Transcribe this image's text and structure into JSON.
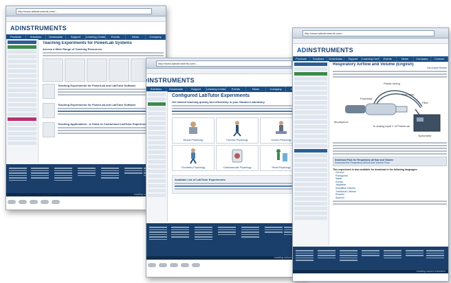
{
  "address_url": "http://www.adinstruments.com/...",
  "logo": {
    "ad": "AD",
    "rest": "INSTRUMENTS"
  },
  "nav_items": [
    "Products",
    "Solutions",
    "Downloads",
    "Support",
    "Learning Center",
    "Events",
    "News",
    "Company",
    "Contact"
  ],
  "back_page": {
    "title": "Teaching Experiments for PowerLab Systems",
    "subtitle": "Access a Wide Range of Teaching Resources",
    "sec1": "Teaching Experiments for PowerLab and LabTutor Software",
    "sec2": "Teaching Experiments for PowerLab and LabTutor Software",
    "sec3": "Teaching Applications - A Guide to Customised LabTutor Experiments"
  },
  "mid_page": {
    "title": "Configured LabTutor Experiments",
    "subtitle": "Get started teaching quickly and effectively in your Student Laboratory",
    "tiles": [
      "Muscle Physiology",
      "Exercise Physiology",
      "Human Physiology",
      "Circulatory Physiology",
      "Cardiovascular Physiology",
      "Renal Physiology"
    ],
    "box_title": "Available List of LabTutor Experiments"
  },
  "front_page": {
    "title": "Respiratory Airflow and Volume (English)",
    "tag": "Get Adobe Reader",
    "labels": [
      "Flowhead",
      "Plastic tubing",
      "Flow head",
      "Filter",
      "Mouthpiece",
      "Spirometer",
      "To analog input 1 of PowerLab"
    ],
    "box1": "Download Pack for Respiratory Airflow and Volume",
    "box2": "Download the Respiratory Airflow and Volume Pack",
    "lang_heading": "This experiment is also available for download in the following languages:",
    "languages": [
      "German",
      "Portuguese",
      "Italian",
      "Korean",
      "Japanese",
      "Simplified Chinese",
      "Traditional Chinese",
      "Russian",
      "Spanish"
    ]
  },
  "footer_tag": "enabling science education",
  "colors": {
    "nav": "#1a4f86",
    "footer": "#1a3f6a",
    "accent_green": "#3b8a4a",
    "accent_magenta": "#b8326b"
  }
}
